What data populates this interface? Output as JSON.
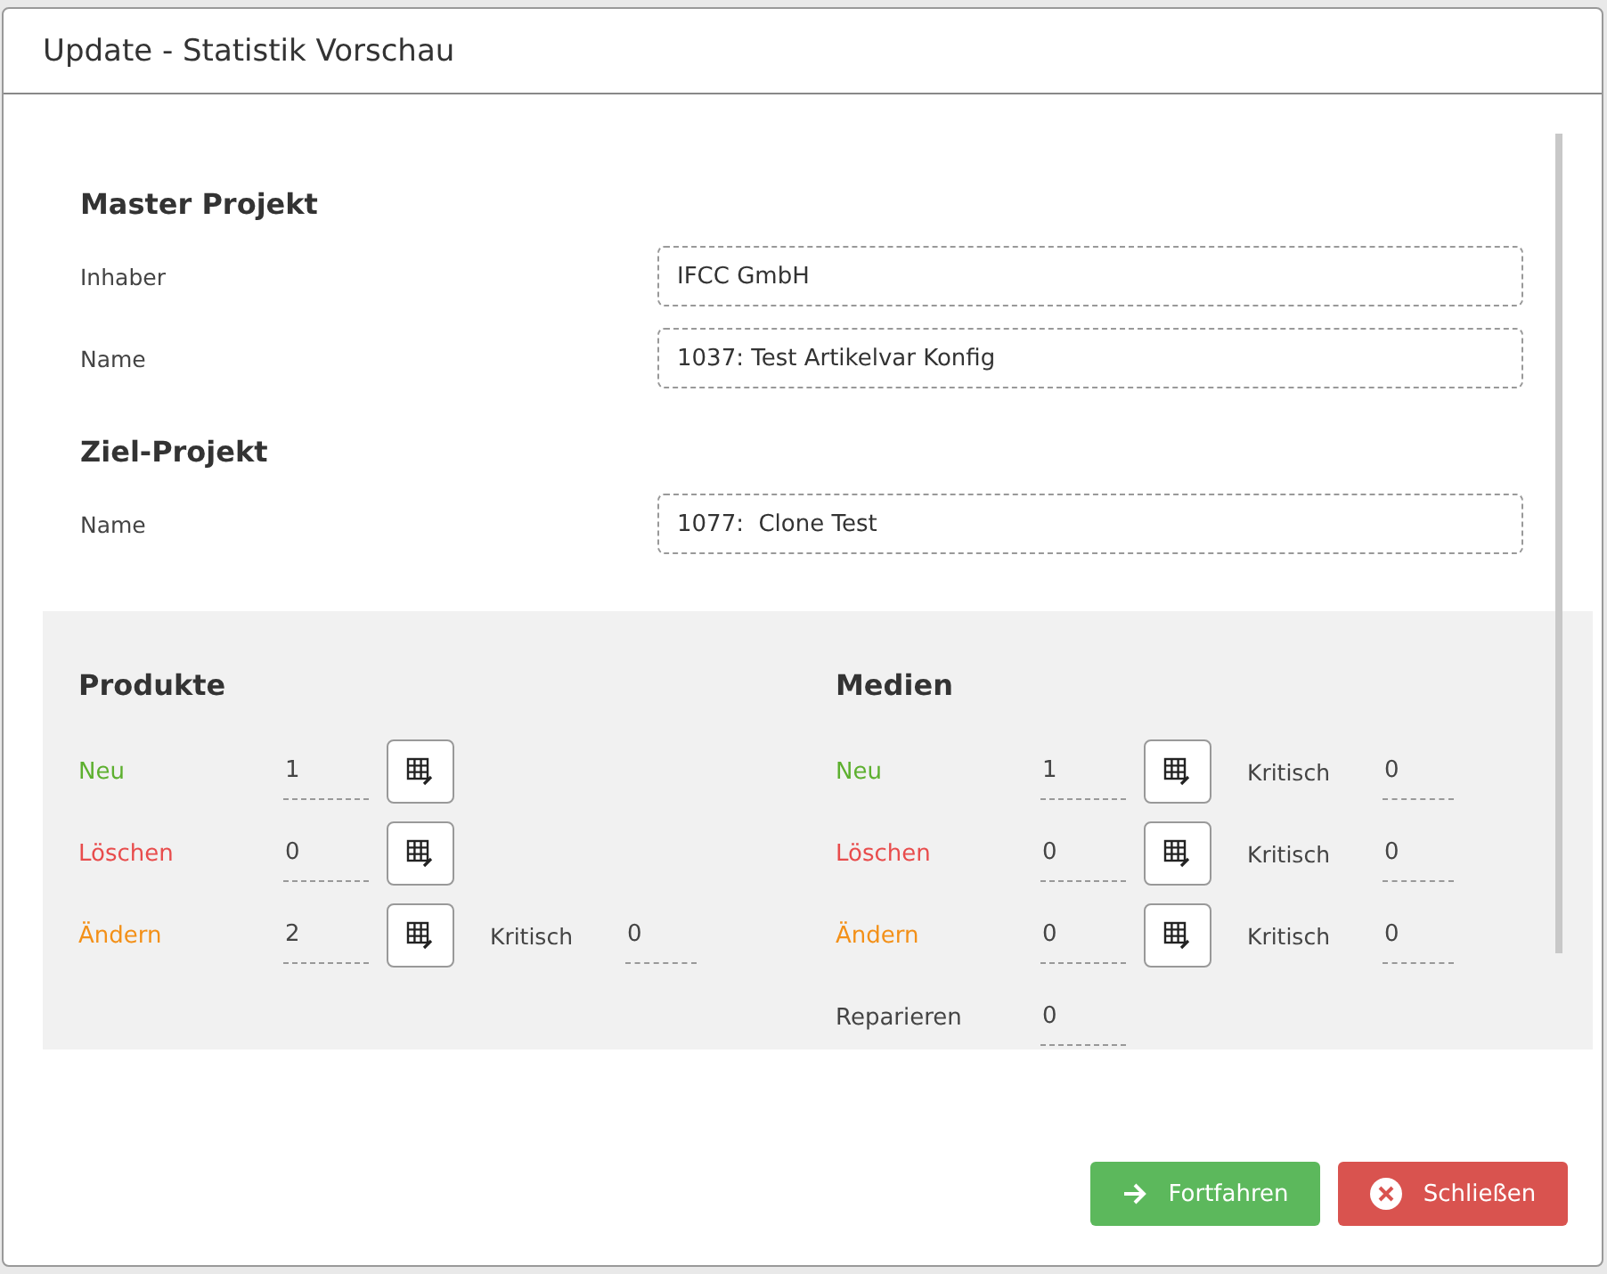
{
  "window": {
    "title": "Update - Statistik Vorschau"
  },
  "master": {
    "heading": "Master Projekt",
    "fields": [
      {
        "label": "Inhaber",
        "value": "IFCC GmbH"
      },
      {
        "label": "Name",
        "value": "1037: Test Artikelvar Konfig"
      }
    ]
  },
  "target": {
    "heading": "Ziel-Projekt",
    "fields": [
      {
        "label": "Name",
        "value": "1077:  Clone Test"
      }
    ]
  },
  "stats": [
    {
      "heading": "Produkte",
      "rows": [
        {
          "kind": "new",
          "label": "Neu",
          "value": "1",
          "has_button": true
        },
        {
          "kind": "delete",
          "label": "Löschen",
          "value": "0",
          "has_button": true
        },
        {
          "kind": "change",
          "label": "Ändern",
          "value": "2",
          "has_button": true,
          "critical_label": "Kritisch",
          "critical_value": "0"
        }
      ]
    },
    {
      "heading": "Medien",
      "rows": [
        {
          "kind": "new",
          "label": "Neu",
          "value": "1",
          "has_button": true,
          "critical_label": "Kritisch",
          "critical_value": "0"
        },
        {
          "kind": "delete",
          "label": "Löschen",
          "value": "0",
          "has_button": true,
          "critical_label": "Kritisch",
          "critical_value": "0"
        },
        {
          "kind": "change",
          "label": "Ändern",
          "value": "0",
          "has_button": true,
          "critical_label": "Kritisch",
          "critical_value": "0"
        },
        {
          "kind": "repair",
          "label": "Reparieren",
          "value": "0",
          "has_button": false
        }
      ]
    }
  ],
  "buttons": [
    {
      "kind": "continue",
      "label": "Fortfahren"
    },
    {
      "kind": "close",
      "label": "Schließen"
    }
  ]
}
